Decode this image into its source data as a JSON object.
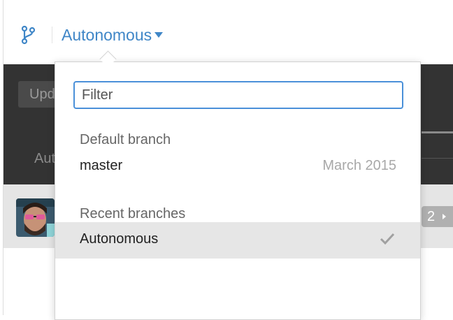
{
  "toolbar": {
    "current_branch": "Autonomous",
    "icons": {
      "branch": "git-branch-icon",
      "caret": "caret-down-icon"
    }
  },
  "background": {
    "update_button": "Upd",
    "author_label": "Aut",
    "commit_count_badge": "2"
  },
  "branch_dropdown": {
    "filter": {
      "placeholder": "Filter",
      "value": ""
    },
    "default_section_title": "Default branch",
    "default_branches": [
      {
        "name": "master",
        "date": "March 2015"
      }
    ],
    "recent_section_title": "Recent branches",
    "recent_branches": [
      {
        "name": "Autonomous",
        "selected": true,
        "icon": "checkmark-icon"
      }
    ]
  },
  "colors": {
    "accent": "#3f86c7",
    "focus_ring": "#4a90d9",
    "dark_panel": "#333333",
    "selected_row": "#e6e6e6"
  }
}
